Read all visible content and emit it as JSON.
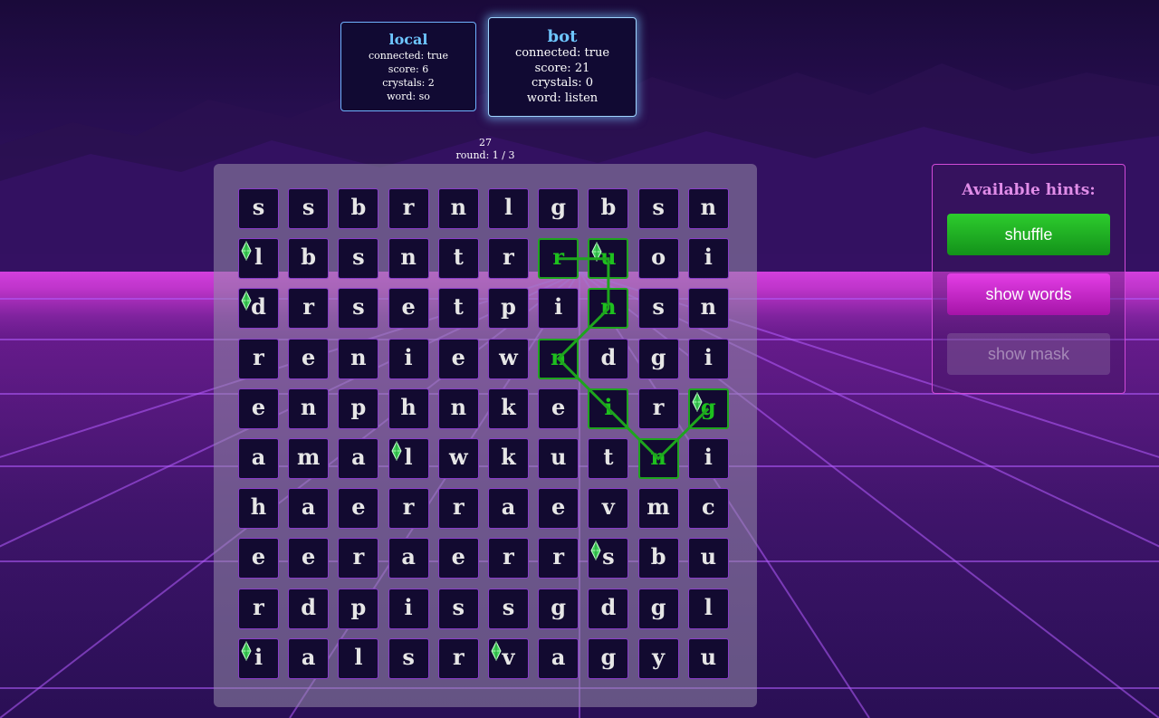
{
  "players": [
    {
      "name": "local",
      "connected": "connected: true",
      "score": "score: 6",
      "crystals": "crystals: 2",
      "word": "word: so"
    },
    {
      "name": "bot",
      "connected": "connected: true",
      "score": "score: 21",
      "crystals": "crystals: 0",
      "word": "word: listen"
    }
  ],
  "timer": {
    "seconds": "27",
    "round": "round: 1 / 3"
  },
  "board": {
    "rows": [
      [
        "s",
        "s",
        "b",
        "r",
        "n",
        "l",
        "g",
        "b",
        "s",
        "n"
      ],
      [
        "l",
        "b",
        "s",
        "n",
        "t",
        "r",
        "r",
        "u",
        "o",
        "i"
      ],
      [
        "d",
        "r",
        "s",
        "e",
        "t",
        "p",
        "i",
        "n",
        "s",
        "n"
      ],
      [
        "r",
        "e",
        "n",
        "i",
        "e",
        "w",
        "n",
        "d",
        "g",
        "i"
      ],
      [
        "e",
        "n",
        "p",
        "h",
        "n",
        "k",
        "e",
        "i",
        "r",
        "g"
      ],
      [
        "a",
        "m",
        "a",
        "l",
        "w",
        "k",
        "u",
        "t",
        "n",
        "i"
      ],
      [
        "h",
        "a",
        "e",
        "r",
        "r",
        "a",
        "e",
        "v",
        "m",
        "c"
      ],
      [
        "e",
        "e",
        "r",
        "a",
        "e",
        "r",
        "r",
        "s",
        "b",
        "u"
      ],
      [
        "r",
        "d",
        "p",
        "i",
        "s",
        "s",
        "g",
        "d",
        "g",
        "l"
      ],
      [
        "i",
        "a",
        "l",
        "s",
        "r",
        "v",
        "a",
        "g",
        "y",
        "u"
      ]
    ],
    "crystals": [
      [
        1,
        0
      ],
      [
        2,
        0
      ],
      [
        1,
        7
      ],
      [
        4,
        9
      ],
      [
        5,
        3
      ],
      [
        7,
        7
      ],
      [
        9,
        0
      ],
      [
        9,
        5
      ]
    ],
    "selected_path": [
      [
        1,
        6
      ],
      [
        1,
        7
      ],
      [
        2,
        7
      ],
      [
        3,
        6
      ],
      [
        4,
        7
      ],
      [
        5,
        8
      ],
      [
        4,
        9
      ]
    ],
    "path_color": "#1ea51e"
  },
  "hints": {
    "title": "Available hints:",
    "shuffle": "shuffle",
    "show_words": "show words",
    "show_mask": "show mask"
  }
}
